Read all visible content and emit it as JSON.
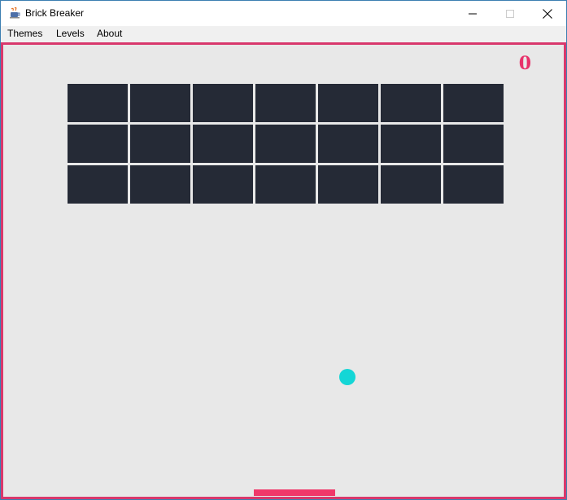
{
  "window": {
    "title": "Brick Breaker"
  },
  "menu": {
    "items": [
      "Themes",
      "Levels",
      "About"
    ]
  },
  "game": {
    "score": "0",
    "brick_rows": 3,
    "brick_columns": 7,
    "colors": {
      "background": "#e8e8e8",
      "border": "#d8386c",
      "brick": "#252a36",
      "ball": "#14d6d6",
      "paddle": "#f0386a",
      "score": "#e8316a"
    }
  }
}
